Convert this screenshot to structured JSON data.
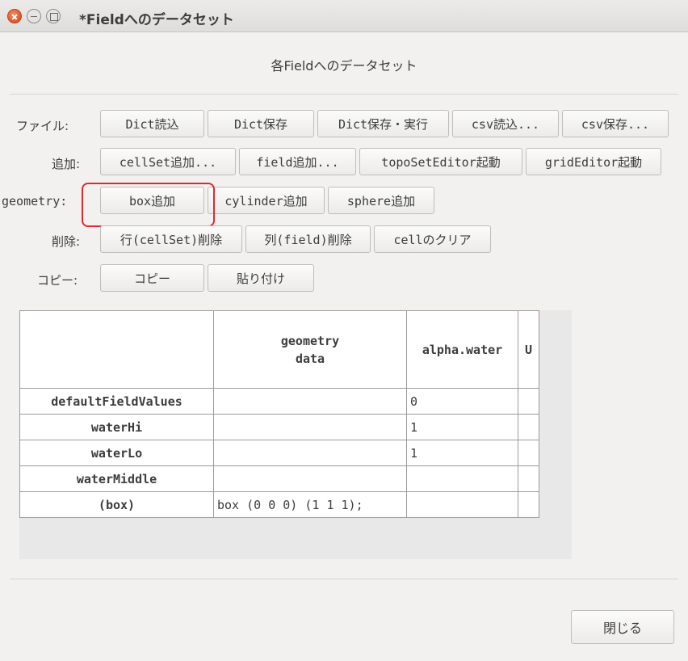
{
  "window": {
    "title": "*Fieldへのデータセット"
  },
  "header": {
    "title": "各Fieldへのデータセット"
  },
  "rows": {
    "file": {
      "label": "ファイル:",
      "buttons": [
        "Dict読込",
        "Dict保存",
        "Dict保存・実行",
        "csv読込...",
        "csv保存..."
      ]
    },
    "add": {
      "label": "追加:",
      "buttons": [
        "cellSet追加...",
        "field追加...",
        "topoSetEditor起動",
        "gridEditor起動"
      ]
    },
    "geometry": {
      "label": "geometry:",
      "buttons": [
        "box追加",
        "cylinder追加",
        "sphere追加"
      ]
    },
    "delete": {
      "label": "削除:",
      "buttons": [
        "行(cellSet)削除",
        "列(field)削除",
        "cellのクリア"
      ]
    },
    "copy": {
      "label": "コピー:",
      "buttons": [
        "コピー",
        "貼り付け"
      ]
    }
  },
  "table": {
    "headers": [
      "",
      "geometry\ndata",
      "alpha.water",
      "U"
    ],
    "rows": [
      [
        "defaultFieldValues",
        "",
        "0",
        ""
      ],
      [
        "waterHi",
        "",
        "1",
        ""
      ],
      [
        "waterLo",
        "",
        "1",
        ""
      ],
      [
        "waterMiddle",
        "",
        "",
        ""
      ],
      [
        "(box)",
        "box (0 0 0) (1 1 1);",
        "",
        ""
      ]
    ]
  },
  "footer": {
    "close_label": "閉じる"
  },
  "colors": {
    "highlight": "#e0282f",
    "close_button": "#e25624"
  }
}
